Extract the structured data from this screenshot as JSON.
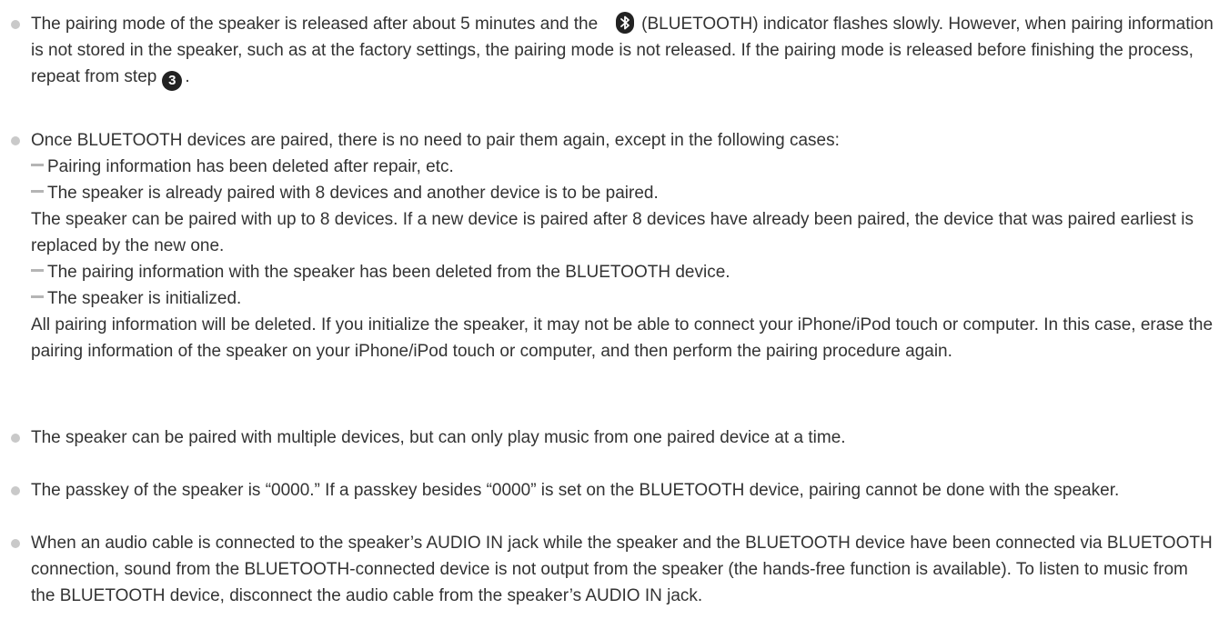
{
  "notes": [
    {
      "text_before_icon": "The pairing mode of the speaker is released after about 5 minutes and the",
      "icon": "bluetooth-icon",
      "text_after_icon": "(BLUETOOTH) indicator flashes slowly. However, when pairing information is not stored in the speaker, such as at the factory settings, the pairing mode is not released. If the pairing mode is released before finishing the process, repeat from step",
      "step_number": "3",
      "text_end": "."
    },
    {
      "intro": "Once BLUETOOTH devices are paired, there is no need to pair them again, except in the following cases:",
      "cases": [
        {
          "label": "Pairing information has been deleted after repair, etc.",
          "detail": ""
        },
        {
          "label": "The speaker is already paired with 8 devices and another device is to be paired.",
          "detail": "The speaker can be paired with up to 8 devices. If a new device is paired after 8 devices have already been paired, the device that was paired earliest is replaced by the new one."
        },
        {
          "label": "The pairing information with the speaker has been deleted from the BLUETOOTH device.",
          "detail": ""
        },
        {
          "label": "The speaker is initialized.",
          "detail": "All pairing information will be deleted. If you initialize the speaker, it may not be able to connect your iPhone/iPod touch or computer. In this case, erase the pairing information of the speaker on your iPhone/iPod touch or computer, and then perform the pairing procedure again."
        }
      ]
    },
    {
      "text": "The speaker can be paired with multiple devices, but can only play music from one paired device at a time."
    },
    {
      "text": "The passkey of the speaker is “0000.” If a passkey besides “0000” is set on the BLUETOOTH device, pairing cannot be done with the speaker."
    },
    {
      "text": "When an audio cable is connected to the speaker’s AUDIO IN jack while the speaker and the BLUETOOTH device have been connected via BLUETOOTH connection, sound from the BLUETOOTH-connected device is not output from the speaker (the hands-free function is available). To listen to music from the BLUETOOTH device, disconnect the audio cable from the speaker’s AUDIO IN jack."
    }
  ]
}
